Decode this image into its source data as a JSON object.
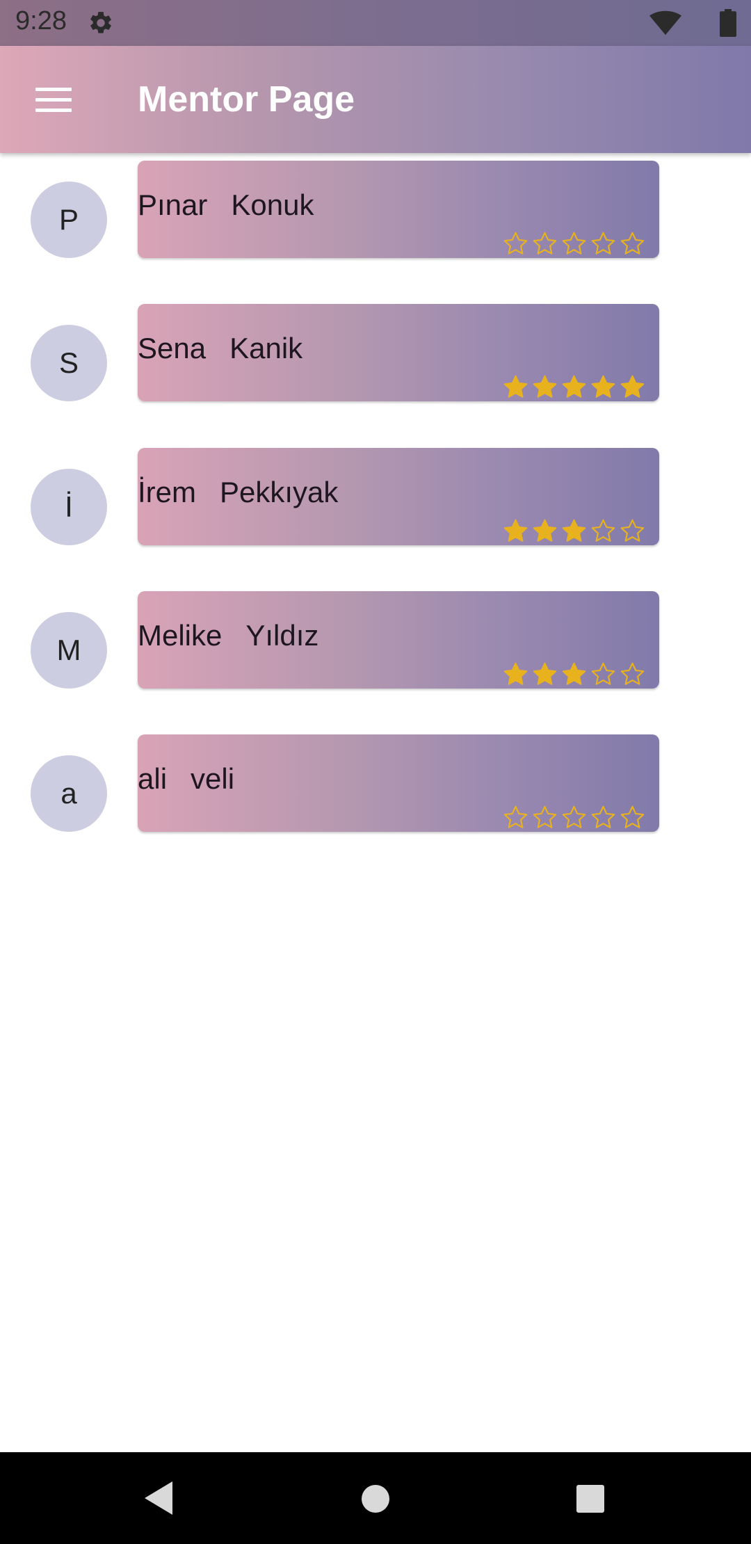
{
  "status_bar": {
    "time": "9:28",
    "icons": [
      "settings-gear-icon",
      "wifi-icon",
      "battery-icon"
    ]
  },
  "app_bar": {
    "title": "Mentor Page",
    "menu_icon": "hamburger-menu-icon"
  },
  "colors": {
    "accent_start": "#dda8b8",
    "accent_end": "#8079aa",
    "star": "#e8b21e",
    "avatar_bg": "#cccde0"
  },
  "mentors": [
    {
      "initial": "P",
      "first_name": "Pınar",
      "last_name": "Konuk",
      "rating": 0
    },
    {
      "initial": "S",
      "first_name": "Sena",
      "last_name": "Kanik",
      "rating": 5
    },
    {
      "initial": "İ",
      "first_name": "İrem",
      "last_name": "Pekkıyak",
      "rating": 3
    },
    {
      "initial": "M",
      "first_name": "Melike",
      "last_name": "Yıldız",
      "rating": 3
    },
    {
      "initial": "a",
      "first_name": "ali",
      "last_name": "veli",
      "rating": 0
    }
  ],
  "rating_max": 5,
  "nav_bar": {
    "icons": [
      "back-icon",
      "home-icon",
      "recent-apps-icon"
    ]
  }
}
